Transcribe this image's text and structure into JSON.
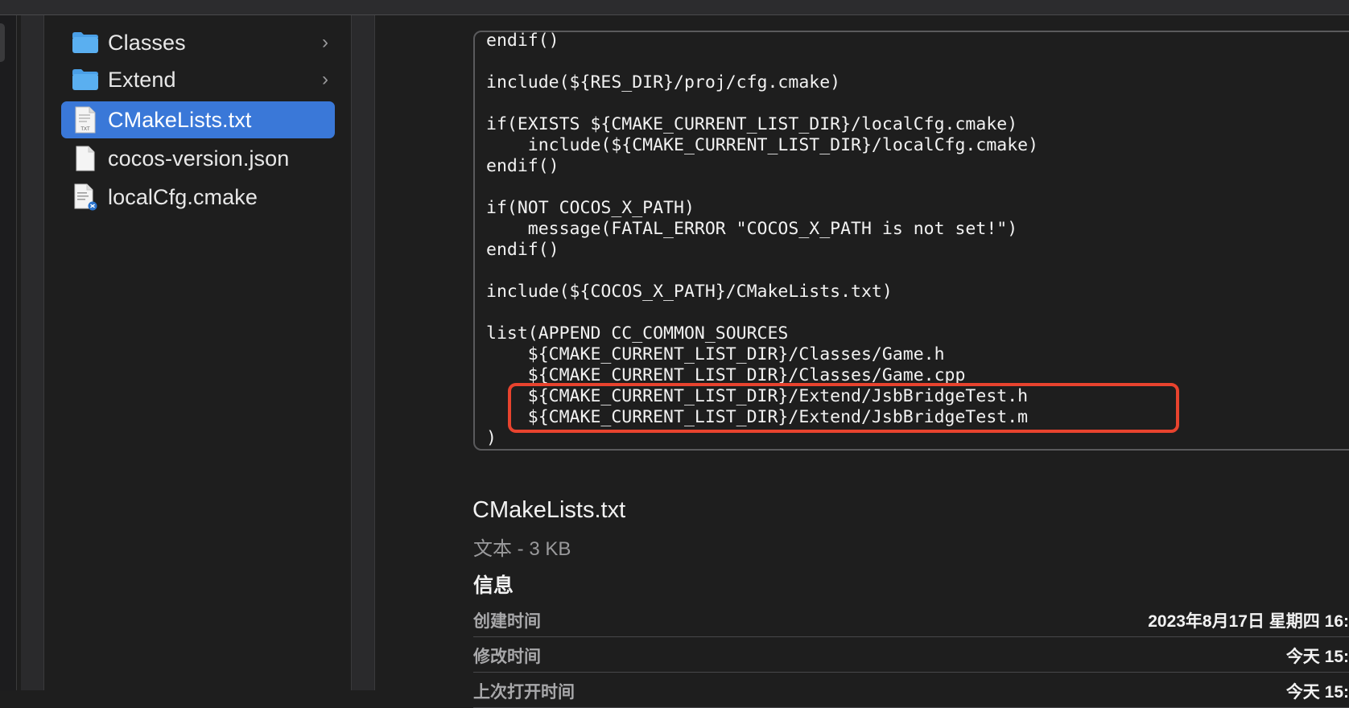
{
  "files": [
    {
      "name": "Classes",
      "type": "folder",
      "has_children": true,
      "selected": false
    },
    {
      "name": "Extend",
      "type": "folder",
      "has_children": true,
      "selected": false
    },
    {
      "name": "CMakeLists.txt",
      "type": "txt",
      "icon_caption": "TXT",
      "has_children": false,
      "selected": true
    },
    {
      "name": "cocos-version.json",
      "type": "blank",
      "has_children": false,
      "selected": false
    },
    {
      "name": "localCfg.cmake",
      "type": "cmake",
      "has_children": false,
      "selected": false
    }
  ],
  "chevron": "›",
  "preview": {
    "code_lines": [
      "endif()",
      "",
      "include(${RES_DIR}/proj/cfg.cmake)",
      "",
      "if(EXISTS ${CMAKE_CURRENT_LIST_DIR}/localCfg.cmake)",
      "    include(${CMAKE_CURRENT_LIST_DIR}/localCfg.cmake)",
      "endif()",
      "",
      "if(NOT COCOS_X_PATH)",
      "    message(FATAL_ERROR \"COCOS_X_PATH is not set!\")",
      "endif()",
      "",
      "include(${COCOS_X_PATH}/CMakeLists.txt)",
      "",
      "list(APPEND CC_COMMON_SOURCES",
      "    ${CMAKE_CURRENT_LIST_DIR}/Classes/Game.h",
      "    ${CMAKE_CURRENT_LIST_DIR}/Classes/Game.cpp",
      "    ${CMAKE_CURRENT_LIST_DIR}/Extend/JsbBridgeTest.h",
      "    ${CMAKE_CURRENT_LIST_DIR}/Extend/JsbBridgeTest.m",
      ")"
    ],
    "file_name": "CMakeLists.txt",
    "file_kind_size": "文本 - 3 KB",
    "info_heading": "信息",
    "info_rows": [
      {
        "key": "创建时间",
        "value": "2023年8月17日 星期四 16:"
      },
      {
        "key": "修改时间",
        "value": "今天 15:"
      },
      {
        "key": "上次打开时间",
        "value": "今天 15:"
      }
    ]
  },
  "colors": {
    "selection": "#3a78d8",
    "folder": "#5aaff0",
    "highlight": "#e8432e"
  }
}
